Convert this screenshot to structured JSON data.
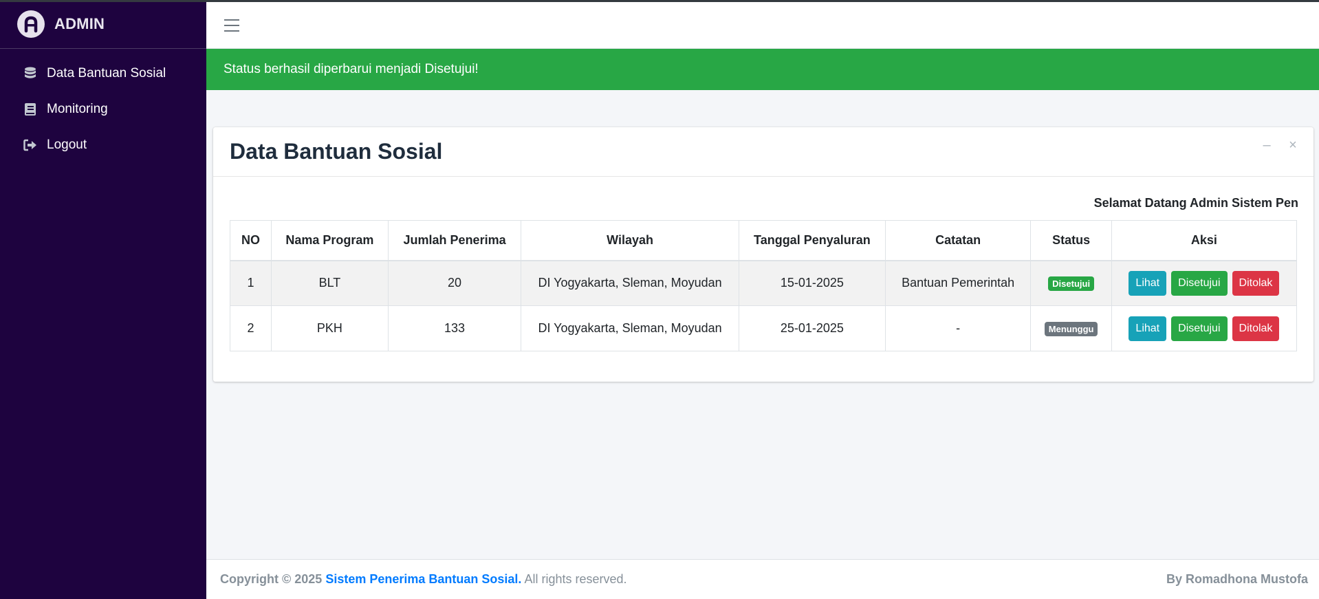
{
  "brand": {
    "name": "ADMIN",
    "logo_icon": "admin-logo-icon"
  },
  "sidebar": {
    "items": [
      {
        "label": "Data Bantuan Sosial",
        "icon": "database-icon"
      },
      {
        "label": "Monitoring",
        "icon": "book-icon"
      },
      {
        "label": "Logout",
        "icon": "sign-out-icon"
      }
    ]
  },
  "topbar": {
    "menu_icon": "hamburger-icon"
  },
  "alert": {
    "message": "Status berhasil diperbarui menjadi Disetujui!",
    "color": "#28a745"
  },
  "card": {
    "title": "Data Bantuan Sosial",
    "tools": {
      "minimize": "–",
      "close": "×"
    },
    "welcome": "Selamat Datang Admin Sistem Pen"
  },
  "table": {
    "headers": [
      "NO",
      "Nama Program",
      "Jumlah Penerima",
      "Wilayah",
      "Tanggal Penyaluran",
      "Catatan",
      "Status",
      "Aksi"
    ],
    "rows": [
      {
        "no": "1",
        "program": "BLT",
        "jumlah": "20",
        "wilayah": "DI Yogyakarta, Sleman, Moyudan",
        "tanggal": "15-01-2025",
        "catatan": "Bantuan Pemerintah",
        "status": "Disetujui"
      },
      {
        "no": "2",
        "program": "PKH",
        "jumlah": "133",
        "wilayah": "DI Yogyakarta, Sleman, Moyudan",
        "tanggal": "25-01-2025",
        "catatan": "-",
        "status": "Menunggu"
      }
    ],
    "actions": {
      "view": "Lihat",
      "approve": "Disetujui",
      "reject": "Ditolak"
    }
  },
  "footer": {
    "copyright_prefix": "Copyright © 2025",
    "site_link": "Sistem Penerima Bantuan Sosial.",
    "rights": "All rights reserved.",
    "author": "By Romadhona Mustofa"
  },
  "colors": {
    "sidebar_bg": "#1e033f",
    "success": "#28a745",
    "info": "#17a2b8",
    "danger": "#dc3545",
    "secondary": "#6c757d",
    "link": "#007bff"
  }
}
